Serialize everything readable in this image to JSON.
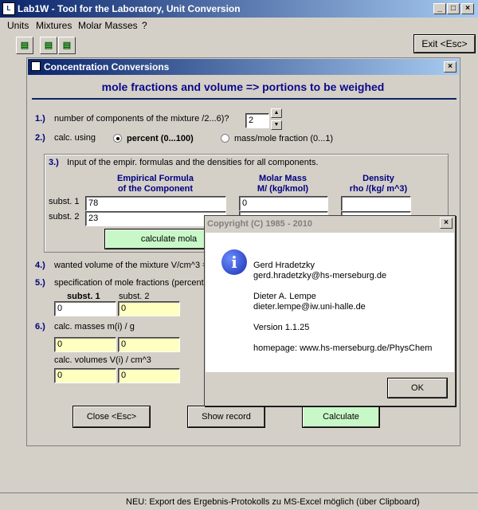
{
  "window": {
    "title": "Lab1W - Tool for the Laboratory, Unit Conversion",
    "buttons": [
      "_",
      "□",
      "X"
    ]
  },
  "menu": [
    "Units",
    "Mixtures",
    "Molar Masses",
    "?"
  ],
  "toolbar": {
    "exit_label": "Exit <Esc>"
  },
  "conc_window": {
    "title": "Concentration Conversions",
    "heading": "mole fractions and volume => portions to be weighed",
    "step1": {
      "num": "1.)",
      "label": "number of components of the mixture /2...6)?",
      "value": "2"
    },
    "step2": {
      "num": "2.)",
      "label": "calc. using",
      "opt_percent": "percent (0...100)",
      "opt_fraction": "mass/mole fraction (0...1)"
    },
    "step3": {
      "num": "3.)",
      "label": "Input of the empir. formulas and the densities for all components.",
      "col1": "Empirical Formula of the Component",
      "col1a": "Empirical Formula",
      "col1b": "of the Component",
      "col2a": "Molar Mass",
      "col2b": "M/ (kg/kmol)",
      "col3a": "Density",
      "col3b": "rho /(kg/ m^3)",
      "rows": [
        {
          "label": "subst. 1",
          "formula": "78",
          "molar_mass": "0",
          "density": ""
        },
        {
          "label": "subst. 2",
          "formula": "23",
          "molar_mass": "",
          "density": ""
        }
      ],
      "calc_button": "calculate mola"
    },
    "step4": {
      "num": "4.)",
      "label": "wanted volume of the mixture V/cm^3 ="
    },
    "step5": {
      "num": "5.)",
      "label": "specification of mole fractions (percent)",
      "h1": "subst. 1",
      "h2": "subst. 2",
      "v1": "0",
      "v2": "0"
    },
    "step6": {
      "num": "6.)",
      "label": "calc. masses m(i) / g",
      "m1": "0",
      "m2": "0",
      "label2": "calc. volumes V(i) / cm^3",
      "v1": "0",
      "v2": "0"
    },
    "buttons": {
      "close": "Close <Esc>",
      "show": "Show record",
      "calc": "Calculate"
    }
  },
  "dialog": {
    "title": "Copyright (C) 1985 - 2010",
    "author1": "Gerd Hradetzky",
    "email1": "gerd.hradetzky@hs-merseburg.de",
    "author2": "Dieter A. Lempe",
    "email2": "dieter.lempe@iw.uni-halle.de",
    "version": "Version 1.1.25",
    "homepage": "homepage: www.hs-merseburg.de/PhysChem",
    "ok": "OK"
  },
  "status": "NEU: Export des Ergebnis-Protokolls zu MS-Excel möglich (über Clipboard)"
}
